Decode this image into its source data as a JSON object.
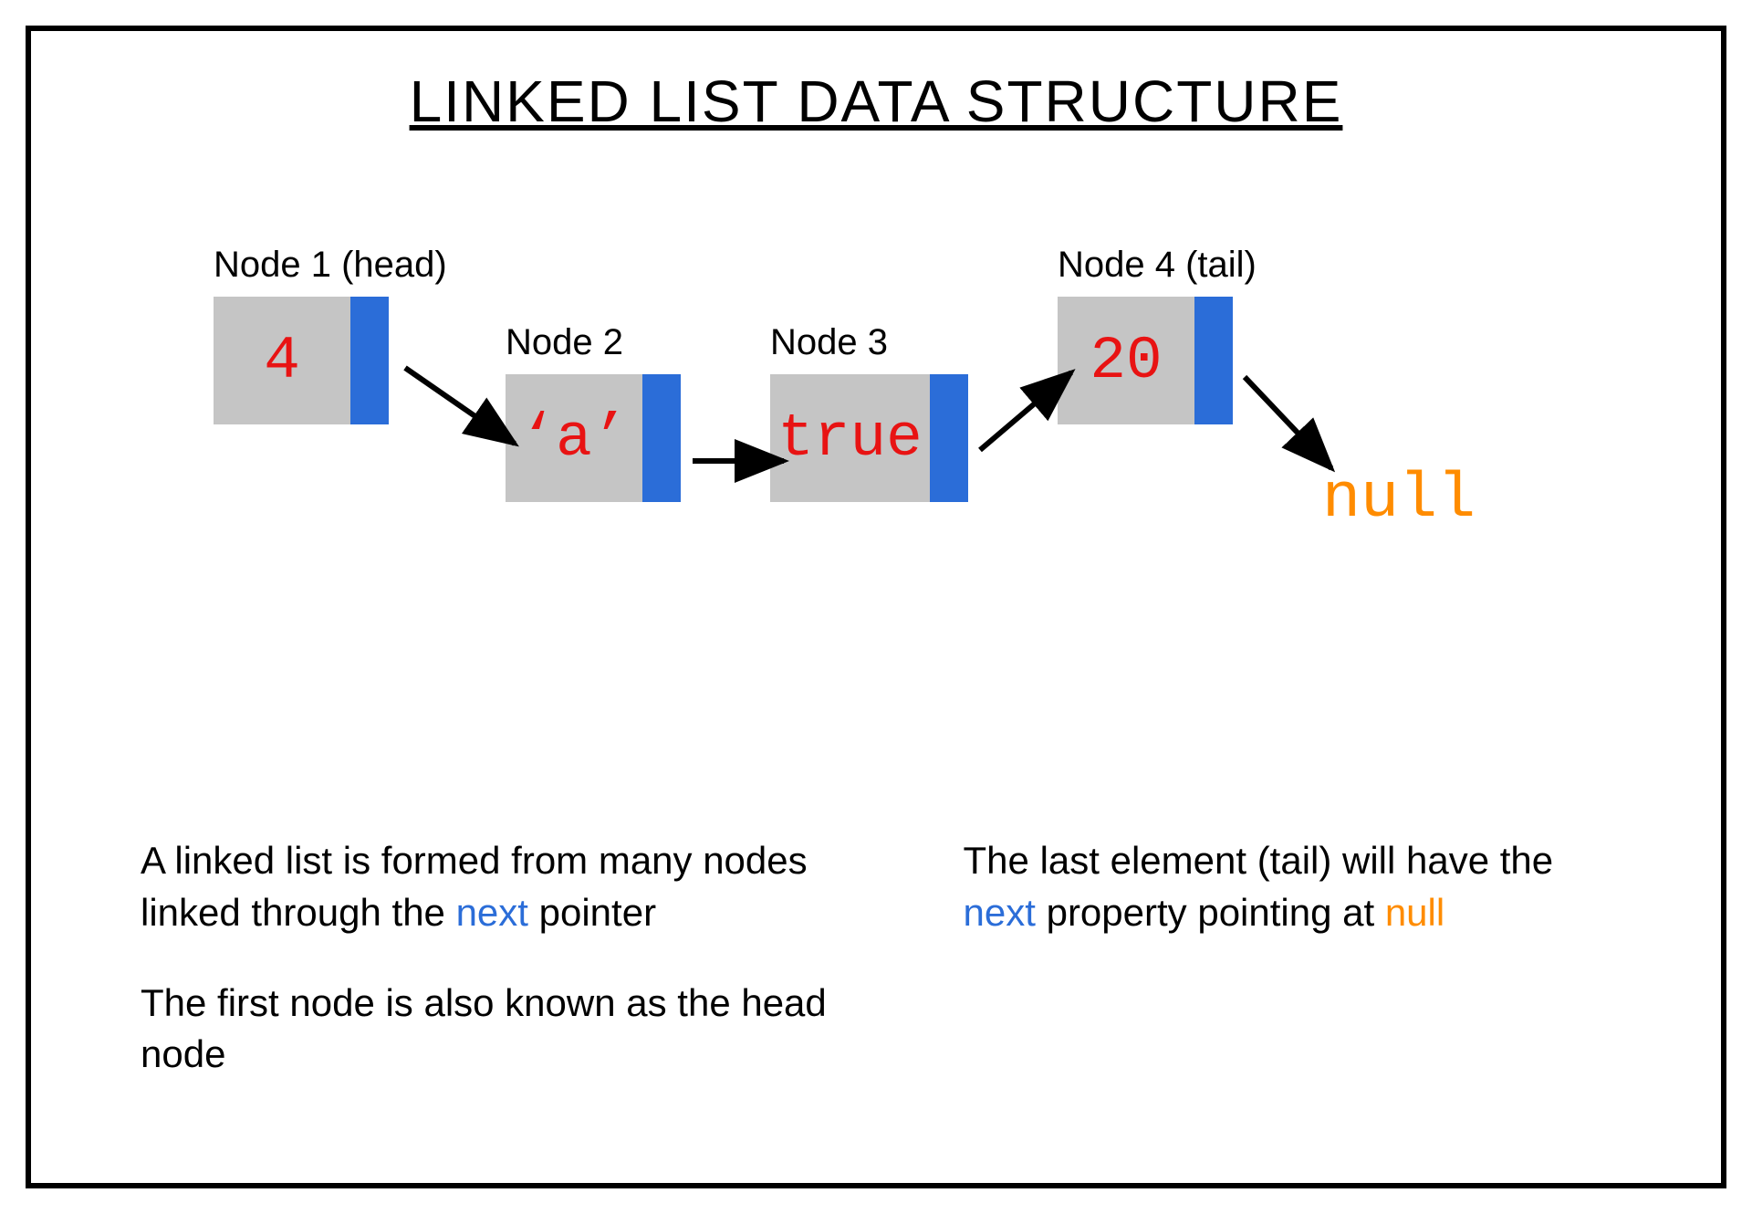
{
  "title": "LINKED LIST DATA STRUCTURE",
  "nodes": [
    {
      "label": "Node 1 (head)",
      "value": "4"
    },
    {
      "label": "Node 2",
      "value": "‘a’"
    },
    {
      "label": "Node 3",
      "value": "true"
    },
    {
      "label": "Node 4 (tail)",
      "value": "20"
    }
  ],
  "null_label": "null",
  "desc": {
    "left": {
      "p1_pre": "A linked list is formed from many nodes linked through the ",
      "p1_kw": "next",
      "p1_post": " pointer",
      "p2": "The first node is also known as the head node"
    },
    "right": {
      "pre": "The last element (tail) will have the ",
      "kw1": "next",
      "mid": " property pointing at ",
      "kw2": "null"
    }
  }
}
